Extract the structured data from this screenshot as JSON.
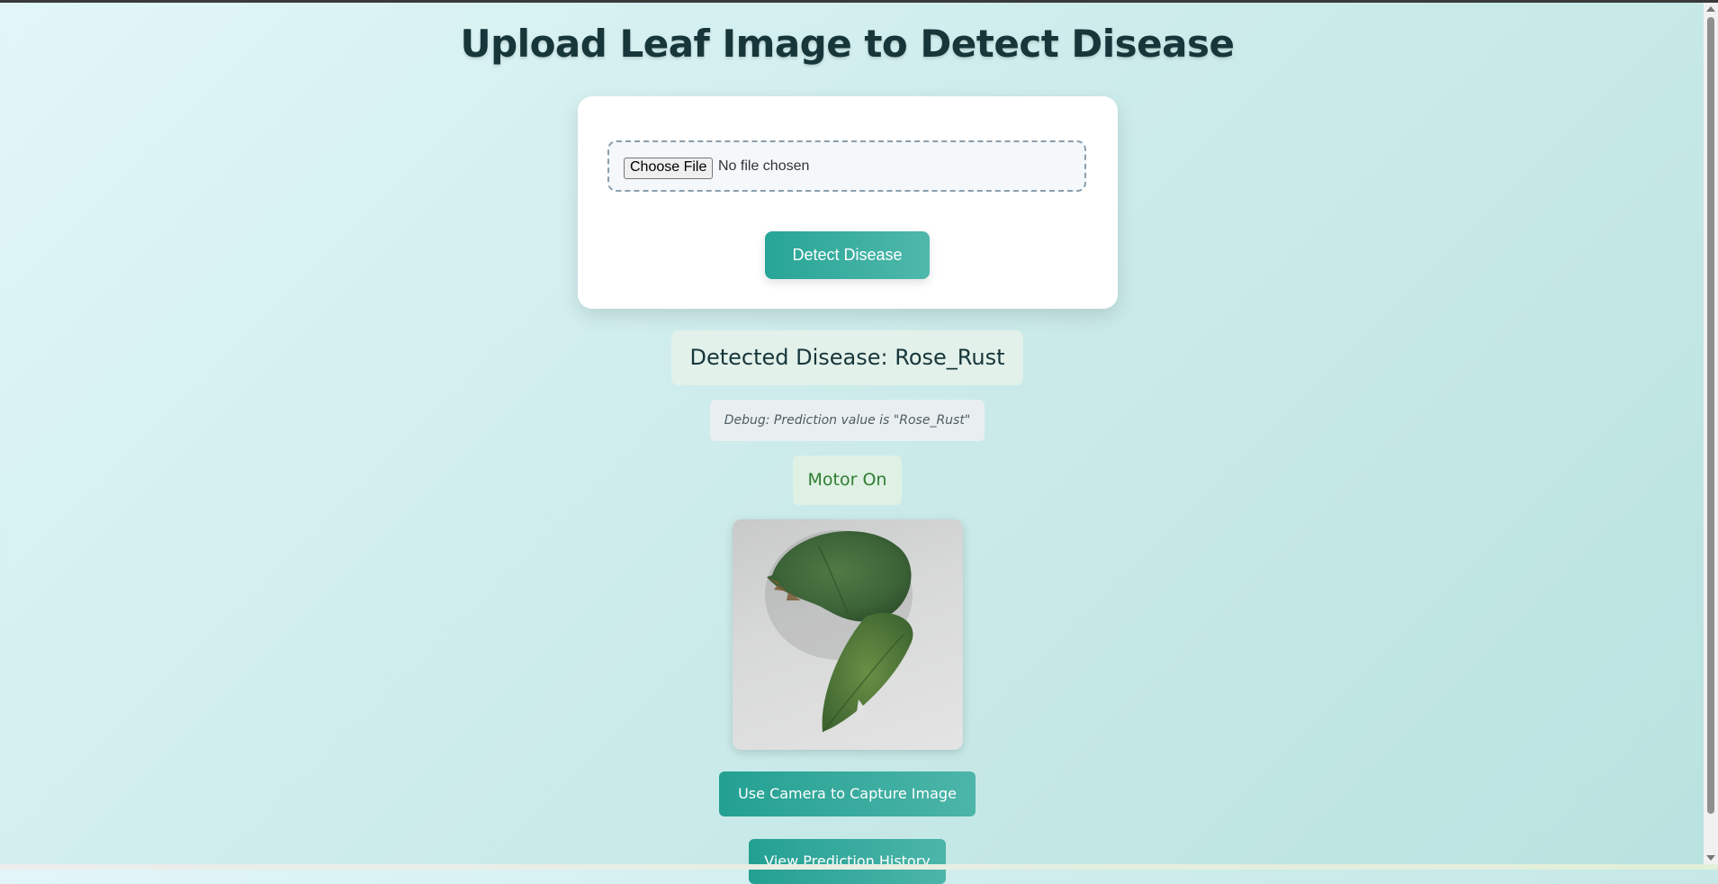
{
  "page": {
    "title": "Upload Leaf Image to Detect Disease"
  },
  "upload": {
    "choose_file_label": "Choose File",
    "file_status": "No file chosen",
    "detect_button": "Detect Disease"
  },
  "result": {
    "detected_text": "Detected Disease: Rose_Rust",
    "debug_text": "Debug: Prediction value is \"Rose_Rust\"",
    "motor_status": "Motor On"
  },
  "actions": {
    "camera_button": "Use Camera to Capture Image",
    "history_button": "View Prediction History"
  },
  "colors": {
    "accent": "#27a596",
    "title": "#17363a",
    "motor_text": "#2f7d32"
  }
}
